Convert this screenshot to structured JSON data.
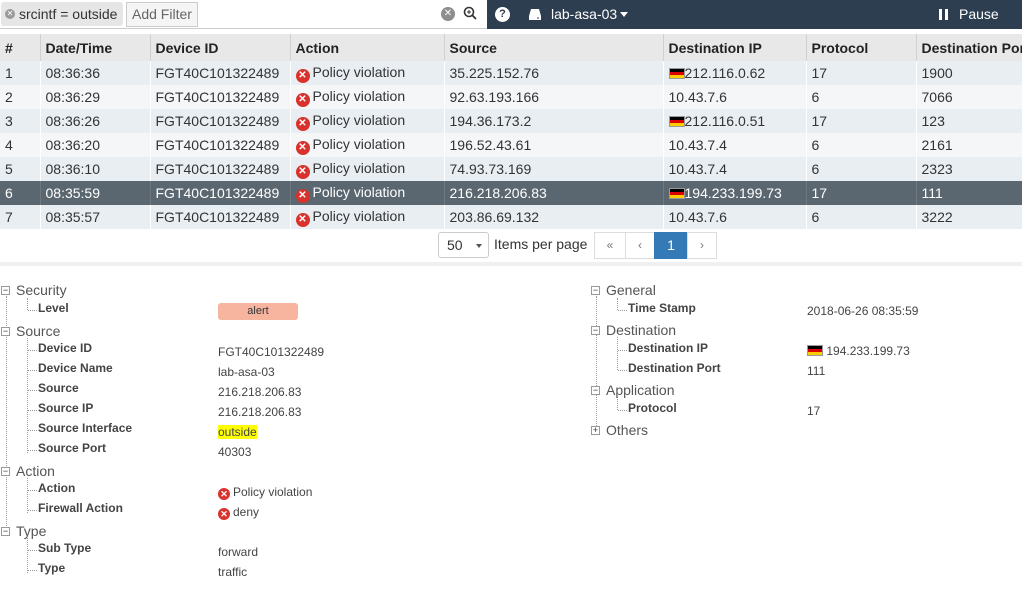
{
  "filter_bar": {
    "chip_label": "srcintf = outside",
    "add_filter_label": "Add Filter"
  },
  "topbar": {
    "device": "lab-asa-03",
    "pause_label": "Pause"
  },
  "table": {
    "columns": [
      "#",
      "Date/Time",
      "Device ID",
      "Action",
      "Source",
      "Destination IP",
      "Protocol",
      "Destination Port"
    ],
    "rows": [
      {
        "num": "1",
        "time": "08:36:36",
        "device_id": "FGT40C101322489",
        "action": "Policy violation",
        "source": "35.225.152.76",
        "dest_ip": "212.116.0.62",
        "flag": true,
        "protocol": "17",
        "dest_port": "1900"
      },
      {
        "num": "2",
        "time": "08:36:29",
        "device_id": "FGT40C101322489",
        "action": "Policy violation",
        "source": "92.63.193.166",
        "dest_ip": "10.43.7.6",
        "flag": false,
        "protocol": "6",
        "dest_port": "7066"
      },
      {
        "num": "3",
        "time": "08:36:26",
        "device_id": "FGT40C101322489",
        "action": "Policy violation",
        "source": "194.36.173.2",
        "dest_ip": "212.116.0.51",
        "flag": true,
        "protocol": "17",
        "dest_port": "123"
      },
      {
        "num": "4",
        "time": "08:36:20",
        "device_id": "FGT40C101322489",
        "action": "Policy violation",
        "source": "196.52.43.61",
        "dest_ip": "10.43.7.4",
        "flag": false,
        "protocol": "6",
        "dest_port": "2161"
      },
      {
        "num": "5",
        "time": "08:36:10",
        "device_id": "FGT40C101322489",
        "action": "Policy violation",
        "source": "74.93.73.169",
        "dest_ip": "10.43.7.4",
        "flag": false,
        "protocol": "6",
        "dest_port": "2323"
      },
      {
        "num": "6",
        "time": "08:35:59",
        "device_id": "FGT40C101322489",
        "action": "Policy violation",
        "source": "216.218.206.83",
        "dest_ip": "194.233.199.73",
        "flag": true,
        "protocol": "17",
        "dest_port": "111"
      },
      {
        "num": "7",
        "time": "08:35:57",
        "device_id": "FGT40C101322489",
        "action": "Policy violation",
        "source": "203.86.69.132",
        "dest_ip": "10.43.7.6",
        "flag": false,
        "protocol": "6",
        "dest_port": "3222"
      }
    ],
    "selected_row": 6
  },
  "pagination": {
    "per_page": "50",
    "per_page_label": "Items per page",
    "first": "«",
    "prev": "‹",
    "page": "1",
    "next": "›"
  },
  "details": {
    "security": {
      "label": "Security",
      "level_label": "Level",
      "level_value": "alert"
    },
    "source": {
      "label": "Source",
      "fields": [
        {
          "label": "Device ID",
          "value": "FGT40C101322489"
        },
        {
          "label": "Device Name",
          "value": "lab-asa-03"
        },
        {
          "label": "Source",
          "value": "216.218.206.83"
        },
        {
          "label": "Source IP",
          "value": "216.218.206.83"
        },
        {
          "label": "Source Interface",
          "value": "outside"
        },
        {
          "label": "Source Port",
          "value": "40303"
        }
      ]
    },
    "action": {
      "label": "Action",
      "fields": [
        {
          "label": "Action",
          "value": "Policy violation"
        },
        {
          "label": "Firewall Action",
          "value": "deny"
        }
      ]
    },
    "type": {
      "label": "Type",
      "fields": [
        {
          "label": "Sub Type",
          "value": "forward"
        },
        {
          "label": "Type",
          "value": "traffic"
        }
      ]
    },
    "general": {
      "label": "General",
      "time_stamp_label": "Time Stamp",
      "time_stamp": "2018-06-26 08:35:59"
    },
    "destination": {
      "label": "Destination",
      "ip_label": "Destination IP",
      "ip": "194.233.199.73",
      "port_label": "Destination Port",
      "port": "111"
    },
    "application": {
      "label": "Application",
      "protocol_label": "Protocol",
      "protocol": "17"
    },
    "others": {
      "label": "Others"
    }
  },
  "colors": {
    "topbar": "#2c3e50",
    "selected_row": "#5b6770",
    "error": "#d9322d",
    "page_active": "#337ab7",
    "alert_badge": "#f7b5a0",
    "highlight": "#ffff00"
  }
}
